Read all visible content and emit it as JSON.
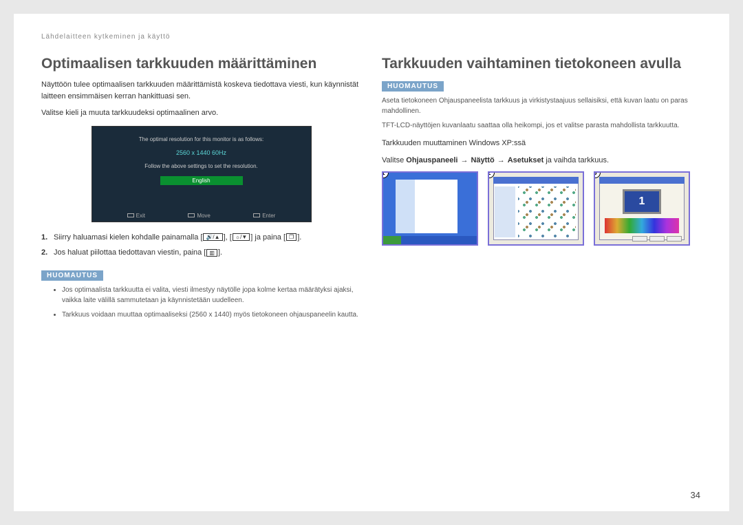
{
  "breadcrumb": "Lähdelaitteen kytkeminen ja käyttö",
  "page_number": "34",
  "left": {
    "heading": "Optimaalisen tarkkuuden määrittäminen",
    "intro": "Näyttöön tulee optimaalisen tarkkuuden määrittämistä koskeva tiedottava viesti, kun käynnistät laitteen ensimmäisen kerran hankittuasi sen.",
    "select_lang": "Valitse kieli ja muuta tarkkuudeksi optimaalinen arvo.",
    "osd": {
      "line1": "The optimal resolution for this monitor is as follows:",
      "resolution": "2560 x 1440  60Hz",
      "line2": "Follow the above settings to set the resolution.",
      "language": "English",
      "exit": "Exit",
      "move": "Move",
      "enter": "Enter"
    },
    "step1_a": "Siirry haluamasi kielen kohdalle painamalla [",
    "step1_b": "], [",
    "step1_c": "] ja paina [",
    "step1_d": "].",
    "step2_a": "Jos haluat piilottaa tiedottavan viestin, paina [",
    "step2_b": "].",
    "note_label": "HUOMAUTUS",
    "note1": "Jos optimaalista tarkkuutta ei valita, viesti ilmestyy näytölle jopa kolme kertaa määrätyksi ajaksi, vaikka laite välillä sammutetaan ja käynnistetään uudelleen.",
    "note2": "Tarkkuus voidaan muuttaa optimaaliseksi (2560 x 1440) myös tietokoneen ohjauspaneelin kautta."
  },
  "right": {
    "heading": "Tarkkuuden vaihtaminen tietokoneen avulla",
    "note_label": "HUOMAUTUS",
    "note_body1": "Aseta tietokoneen Ohjauspaneelista tarkkuus ja virkistystaajuus sellaisiksi, että kuvan laatu on paras mahdollinen.",
    "note_body2": "TFT-LCD-näyttöjen kuvanlaatu saattaa olla heikompi, jos et valitse parasta mahdollista tarkkuutta.",
    "xp_line": "Tarkkuuden muuttaminen Windows XP:ssä",
    "path_prefix": "Valitse ",
    "path1": "Ohjauspaneeli",
    "path2": "Näyttö",
    "path3": "Asetukset",
    "path_suffix": " ja vaihda tarkkuus.",
    "badges": {
      "b1": "1",
      "b2": "2",
      "b3": "3"
    },
    "thumb3_num": "1"
  }
}
